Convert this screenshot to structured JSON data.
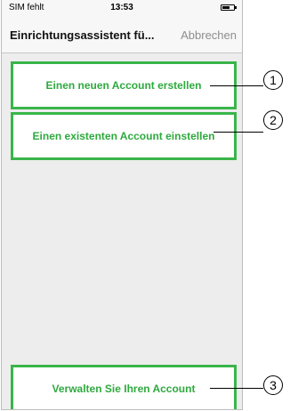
{
  "status_bar": {
    "carrier": "SIM fehlt",
    "time": "13:53",
    "battery_icon": "battery-icon",
    "battery_level": 0.65
  },
  "nav": {
    "title": "Einrichtungsassistent fü...",
    "cancel_label": "Abbrechen"
  },
  "actions": {
    "create_account": "Einen neuen Account erstellen",
    "setup_existing": "Einen existenten Account einstellen",
    "manage_account": "Verwalten Sie Ihren Account"
  },
  "callouts": [
    "1",
    "2",
    "3"
  ],
  "colors": {
    "accent_green": "#39b54a",
    "background": "#ededed"
  }
}
